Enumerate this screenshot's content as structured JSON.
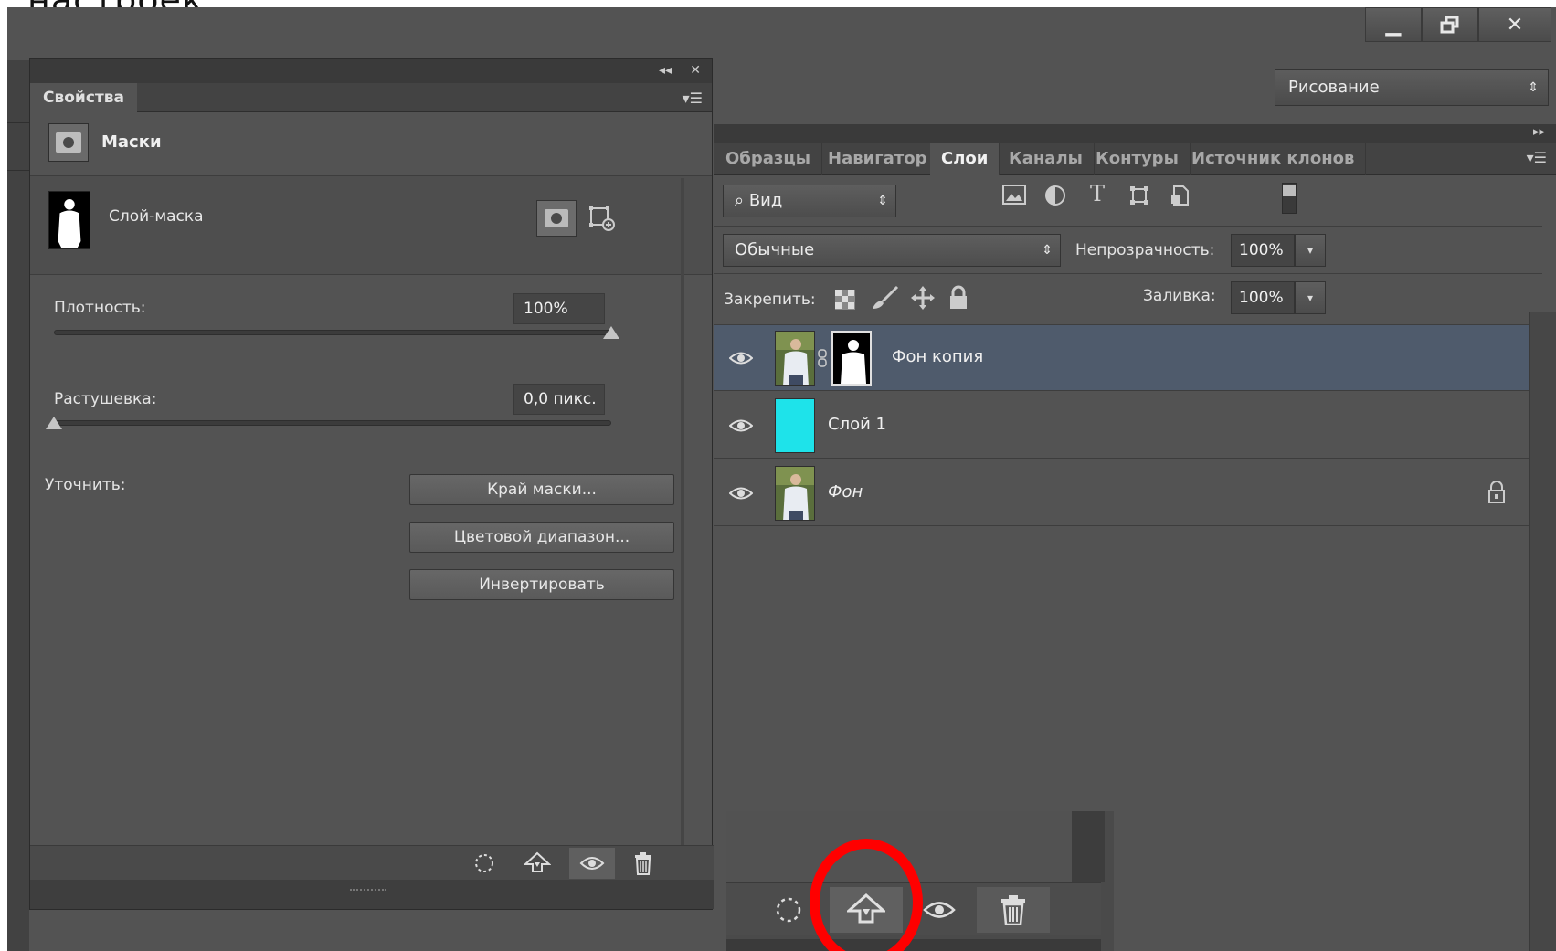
{
  "top_fragment": "настроек",
  "window": {
    "minimize_label": "▁",
    "restore_label": "🗗",
    "close_label": "✕"
  },
  "workspace": {
    "preset": "Рисование"
  },
  "properties_panel": {
    "tab": "Свойства",
    "section_title": "Маски",
    "layer_mask_label": "Слой-маска",
    "density": {
      "label": "Плотность:",
      "value": "100%",
      "level": 1.0
    },
    "feather": {
      "label": "Растушевка:",
      "value": "0,0 пикс.",
      "level": 0.0
    },
    "refine_label": "Уточнить:",
    "buttons": {
      "mask_edge": "Край маски...",
      "color_range": "Цветовой диапазон...",
      "invert": "Инвертировать"
    }
  },
  "layers_panel": {
    "tabs": [
      "Образцы",
      "Навигатор",
      "Слои",
      "Каналы",
      "Контуры",
      "Источник клонов"
    ],
    "active_tab": "Слои",
    "filter": {
      "label": "Вид"
    },
    "blend_mode": "Обычные",
    "opacity": {
      "label": "Непрозрачность:",
      "value": "100%"
    },
    "lock_label": "Закрепить:",
    "fill": {
      "label": "Заливка:",
      "value": "100%"
    },
    "layers": [
      {
        "name": "Фон копия",
        "selected": true,
        "has_mask": true,
        "thumb": "photo"
      },
      {
        "name": "Слой 1",
        "selected": false,
        "has_mask": false,
        "thumb": "cyan",
        "thumb_color": "#1ee3ea"
      },
      {
        "name": "Фон",
        "selected": false,
        "has_mask": false,
        "thumb": "photo",
        "locked": true,
        "italic": true
      }
    ]
  },
  "colors": {
    "panel_bg": "#535353",
    "selected_row": "#4f5b6c",
    "highlight_circle": "#ff0000"
  }
}
